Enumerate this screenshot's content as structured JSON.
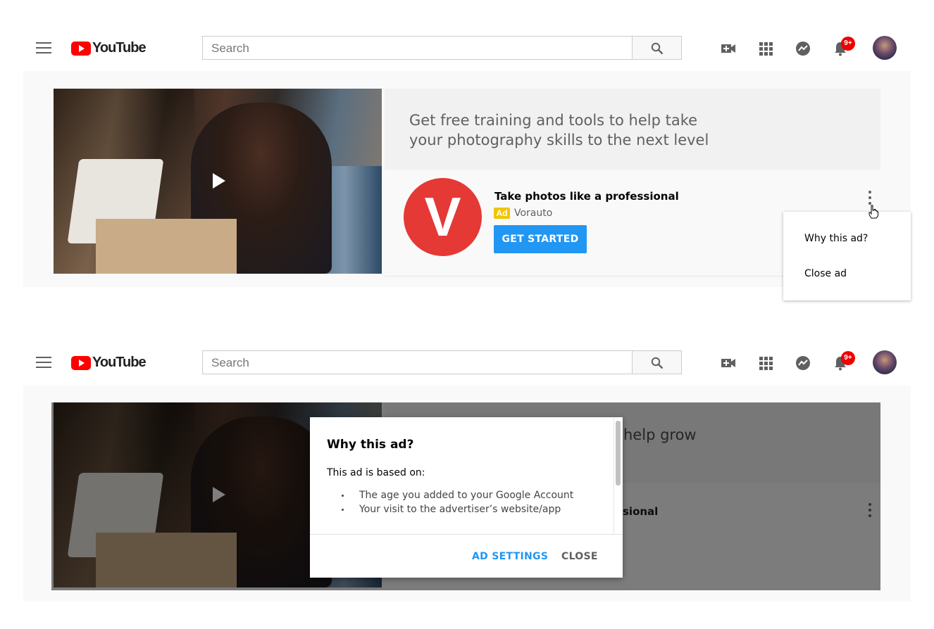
{
  "header": {
    "logo_text": "YouTube",
    "search_placeholder": "Search",
    "notification_count": "9+"
  },
  "ad": {
    "headline": "Get free training and tools to help take your photography skills to the next level",
    "brand_initial": "V",
    "title": "Take photos like a professional",
    "badge": "Ad",
    "advertiser": "Vorauto",
    "cta": "GET STARTED",
    "brand_color": "#e53935",
    "cta_color": "#2196f3"
  },
  "menu": {
    "items": [
      "Why this ad?",
      "Close ad"
    ]
  },
  "dialog": {
    "title": "Why this ad?",
    "subtitle": "This ad is based on:",
    "reasons": [
      "The age you added to your Google Account",
      "Your visit to the advertiser’s website/app"
    ],
    "ad_settings": "AD SETTINGS",
    "close": "CLOSE"
  },
  "background_peek": {
    "headline_fragment": "help grow",
    "title_fragment": "sional"
  }
}
